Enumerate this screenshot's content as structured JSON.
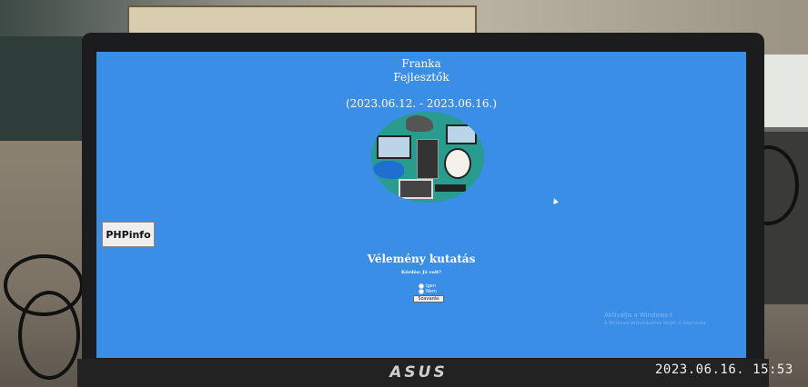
{
  "screen": {
    "title": "Franka",
    "subtitle": "Fejlesztők",
    "dates": "(2023.06.12. - 2023.06.16.)",
    "phpinfo_label": "PHPinfo",
    "survey": {
      "title": "Vélemény kutatás",
      "question": "Kérdés: Jó volt?",
      "options": [
        "Igen",
        "Nem"
      ],
      "selected": "Igen",
      "submit_label": "Szavazás"
    },
    "activate_windows": {
      "title": "Aktiválja a Windows-t",
      "subtitle": "A Windows aktiválásához lépjen a Gépházba."
    },
    "accent_color": "#3b8ee6"
  },
  "laptop": {
    "brand": "ASUS"
  },
  "photo_timestamp": "2023.06.16. 15:53",
  "icons": [
    "logo-circle-illustration",
    "mouse-cursor-icon"
  ]
}
